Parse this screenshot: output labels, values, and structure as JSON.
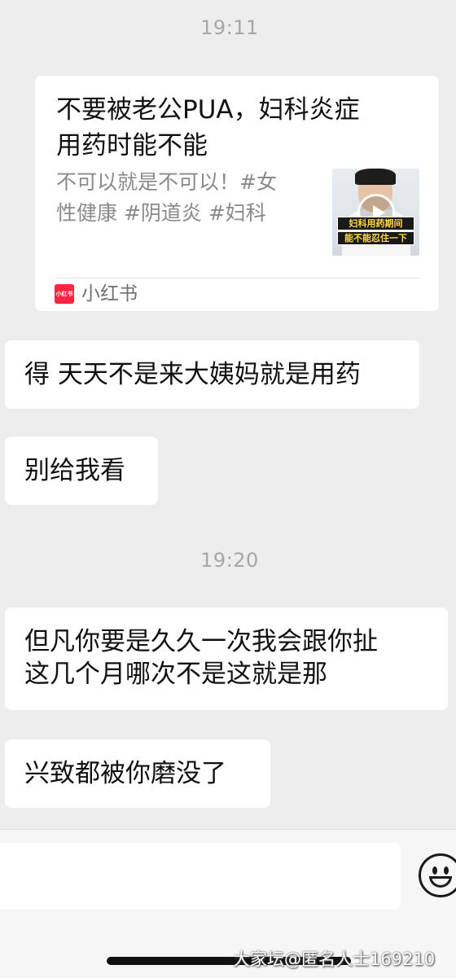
{
  "timestamps": [
    "19:11",
    "19:20"
  ],
  "shared_card": {
    "title_line1": "不要被老公PUA，妇科炎症",
    "title_line2": "用药时能不能",
    "desc_line1": "不可以就是不可以！#女",
    "desc_line2": "性健康  #阴道炎  #妇科",
    "thumb_caption_line1": "妇科用药期间",
    "thumb_caption_line2": "能不能忍住一下",
    "source_logo_text": "小红书",
    "source_name": "小红书"
  },
  "messages": [
    {
      "lines": [
        "得 天天不是来大姨妈就是用药"
      ]
    },
    {
      "lines": [
        "别给我看"
      ]
    },
    {
      "lines": [
        "但凡你要是久久一次我会跟你扯",
        "这几个月哪次不是这就是那"
      ]
    },
    {
      "lines": [
        "兴致都被你磨没了"
      ]
    }
  ],
  "input": {
    "placeholder": "",
    "emoji_icon": "smiley-face-icon"
  },
  "watermark": "大家坛@匿名人士169210"
}
